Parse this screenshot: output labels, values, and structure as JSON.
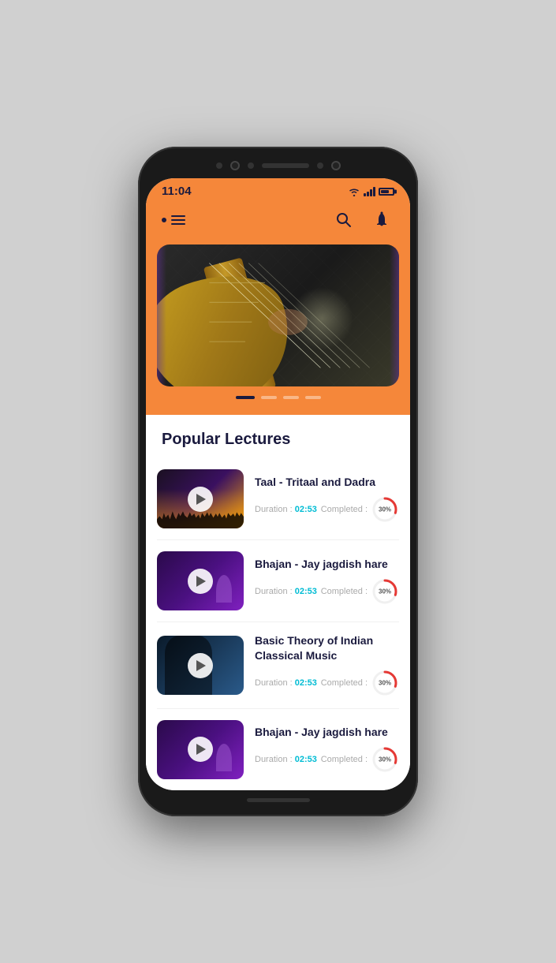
{
  "statusBar": {
    "time": "11:04",
    "wifi": true,
    "signal": true,
    "battery": true
  },
  "header": {
    "searchLabel": "Search",
    "notificationLabel": "Notifications"
  },
  "hero": {
    "slides": [
      {
        "label": "Slide 1",
        "active": true
      },
      {
        "label": "Slide 2",
        "active": false
      },
      {
        "label": "Slide 3",
        "active": false
      },
      {
        "label": "Slide 4",
        "active": false
      }
    ]
  },
  "popularLectures": {
    "sectionTitle": "Popular Lectures",
    "items": [
      {
        "id": 1,
        "title": "Taal - Tritaal and Dadra",
        "durationLabel": "Duration :",
        "durationValue": "02:53",
        "completedLabel": "Completed :",
        "completedValue": "30%",
        "completedNum": 30,
        "thumbType": "concert",
        "playLabel": "Play"
      },
      {
        "id": 2,
        "title": "Bhajan - Jay jagdish hare",
        "durationLabel": "Duration :",
        "durationValue": "02:53",
        "completedLabel": "Completed :",
        "completedValue": "30%",
        "completedNum": 30,
        "thumbType": "bhajan",
        "playLabel": "Play"
      },
      {
        "id": 3,
        "title": "Basic Theory of Indian Classical Music",
        "durationLabel": "Duration :",
        "durationValue": "02:53",
        "completedLabel": "Completed :",
        "completedValue": "30%",
        "completedNum": 30,
        "thumbType": "classical",
        "playLabel": "Play"
      },
      {
        "id": 4,
        "title": "Bhajan - Jay jagdish hare",
        "durationLabel": "Duration :",
        "durationValue": "02:53",
        "completedLabel": "Completed :",
        "completedValue": "30%",
        "completedNum": 30,
        "thumbType": "bhajan",
        "playLabel": "Play"
      }
    ]
  },
  "colors": {
    "orange": "#f5873a",
    "darkNavy": "#1a1a3e",
    "cyan": "#00bcd4",
    "progressRed": "#e53935",
    "progressOrange": "#ff8f00"
  }
}
